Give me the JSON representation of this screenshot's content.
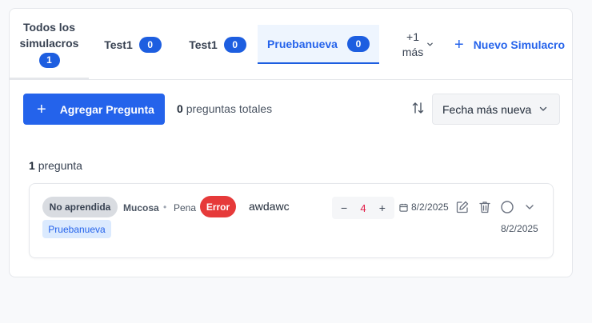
{
  "tabs": [
    {
      "label": "Todos los simulacros",
      "count": "1"
    },
    {
      "label": "Test1",
      "count": "0"
    },
    {
      "label": "Test1",
      "count": "0"
    },
    {
      "label": "Pruebanueva",
      "count": "0"
    }
  ],
  "more_tab": {
    "label": "+1 más"
  },
  "new_simulacro": {
    "label": "Nuevo Simulacro"
  },
  "toolbar": {
    "add_label": "Agregar Pregunta",
    "total_count": "0",
    "total_text": "preguntas totales",
    "sort_value": "Fecha más nueva"
  },
  "list": {
    "count": "1",
    "count_text": "pregunta"
  },
  "question": {
    "status": "No aprendida",
    "category": "Mucosa",
    "separator": "•",
    "subcategory": "Pena",
    "result": "Error",
    "text": "awdawc",
    "simulacro": "Pruebanueva",
    "stepper_minus": "−",
    "stepper_value": "4",
    "stepper_plus": "+",
    "date": "8/2/2025",
    "date_secondary": "8/2/2025"
  },
  "icons": [
    "plus-icon",
    "sort-icon",
    "chevron-down-icon",
    "calendar-icon",
    "edit-icon",
    "trash-icon",
    "circle-icon"
  ],
  "colors": {
    "primary": "#2463eb",
    "error": "#e63a3a",
    "active_tab_bg": "#eef5fe"
  }
}
